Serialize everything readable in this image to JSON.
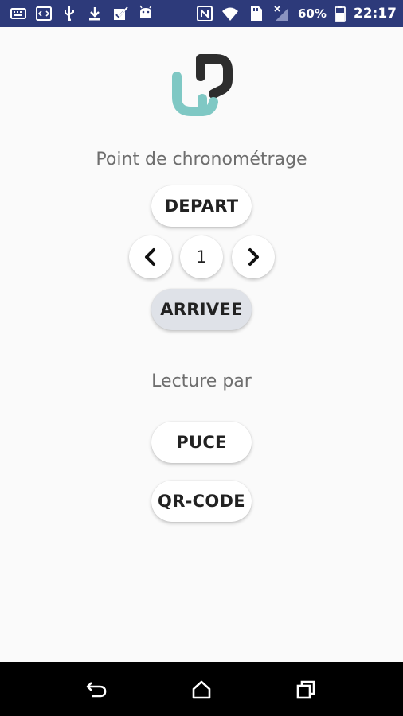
{
  "status_bar": {
    "left_icons": [
      "keyboard-icon",
      "code-icon",
      "usb-icon",
      "download-icon",
      "tasks-icon",
      "android-icon"
    ],
    "right_icons": [
      "nfc-icon",
      "wifi-icon",
      "sd-card-icon",
      "signal-off-icon",
      "battery-icon"
    ],
    "battery_percent": "60%",
    "time": "22:17"
  },
  "app": {
    "logo_icon": "chain-link-logo",
    "colors": {
      "logo_dark": "#2d2d2d",
      "logo_teal": "#7fc8c4",
      "active_button": "#dfe2e8"
    }
  },
  "timing": {
    "heading": "Point de chronométrage",
    "depart_label": "DEPART",
    "prev_icon": "chevron-left-icon",
    "point_number": "1",
    "next_icon": "chevron-right-icon",
    "arrivee_label": "ARRIVEE"
  },
  "reading": {
    "heading": "Lecture par",
    "puce_label": "PUCE",
    "qrcode_label": "QR-CODE"
  },
  "nav_bar": {
    "back_icon": "back-icon",
    "home_icon": "home-icon",
    "recents_icon": "recents-icon"
  }
}
